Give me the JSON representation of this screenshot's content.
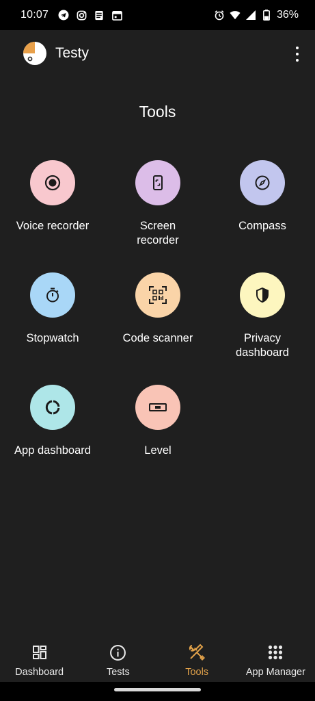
{
  "status_bar": {
    "time": "10:07",
    "battery": "36%",
    "left_icons": [
      "telegram-icon",
      "instagram-icon",
      "notes-icon",
      "calendar-icon"
    ],
    "right_icons": [
      "alarm-icon",
      "wifi-icon",
      "signal-icon",
      "battery-icon"
    ]
  },
  "app_bar": {
    "title": "Testy",
    "logo_colors": [
      "#e8a04a",
      "#ffffff"
    ]
  },
  "page": {
    "title": "Tools"
  },
  "tools": [
    {
      "label": "Voice recorder",
      "icon": "record-icon",
      "color": "#f8c8ce"
    },
    {
      "label": "Screen recorder",
      "icon": "phone-screen-icon",
      "color": "#dcbde8"
    },
    {
      "label": "Compass",
      "icon": "compass-icon",
      "color": "#c2c6ee"
    },
    {
      "label": "Stopwatch",
      "icon": "stopwatch-icon",
      "color": "#a9d7f7"
    },
    {
      "label": "Code scanner",
      "icon": "qr-scanner-icon",
      "color": "#fad4a8"
    },
    {
      "label": "Privacy dashboard",
      "icon": "shield-icon",
      "color": "#fdf6bf"
    },
    {
      "label": "App dashboard",
      "icon": "donut-icon",
      "color": "#aee6e8"
    },
    {
      "label": "Level",
      "icon": "level-icon",
      "color": "#f9c4b6"
    }
  ],
  "bottom_nav": {
    "items": [
      {
        "label": "Dashboard",
        "icon": "dashboard-icon",
        "active": false
      },
      {
        "label": "Tests",
        "icon": "info-icon",
        "active": false
      },
      {
        "label": "Tools",
        "icon": "tools-icon",
        "active": true
      },
      {
        "label": "App Manager",
        "icon": "apps-grid-icon",
        "active": false
      }
    ],
    "accent_color": "#e2a24a"
  }
}
